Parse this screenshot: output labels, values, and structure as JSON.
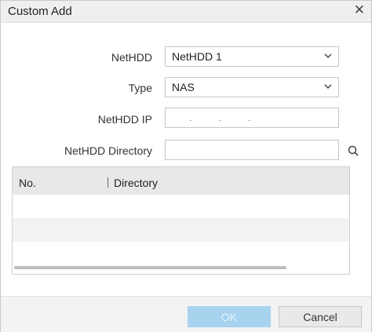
{
  "dialog": {
    "title": "Custom Add",
    "close_icon": "close-icon"
  },
  "form": {
    "nethdd_label": "NetHDD",
    "nethdd_value": "NetHDD 1",
    "type_label": "Type",
    "type_value": "NAS",
    "ip_label": "NetHDD IP",
    "ip_separator": ".",
    "directory_label": "NetHDD Directory",
    "directory_value": "",
    "search_icon": "search-icon"
  },
  "table": {
    "columns": [
      "No.",
      "Directory"
    ],
    "rows": []
  },
  "buttons": {
    "ok_label": "OK",
    "cancel_label": "Cancel"
  },
  "colors": {
    "ok_button_disabled": "#a8d3ef",
    "titlebar": "#efefef",
    "footer": "#f3f3f3"
  }
}
